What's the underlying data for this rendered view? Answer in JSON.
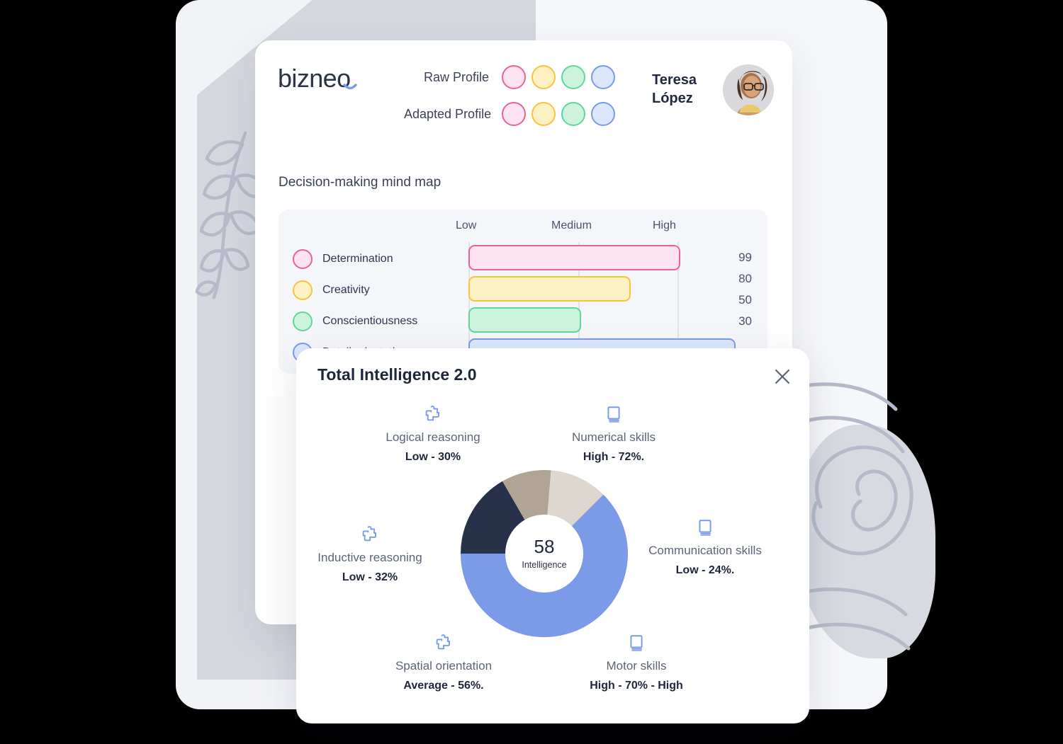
{
  "brand": {
    "logo_text": "bizneo"
  },
  "header": {
    "profile_rows": [
      {
        "label": "Raw Profile",
        "dots": [
          "pink",
          "yellow",
          "green",
          "blue"
        ]
      },
      {
        "label": "Adapted Profile",
        "dots": [
          "pink",
          "yellow",
          "green",
          "blue"
        ]
      }
    ],
    "person": {
      "name_line1": "Teresa",
      "name_line2": "López",
      "avatar_icon": "user-photo"
    }
  },
  "section": {
    "title": "Decision-making mind map"
  },
  "chart_data": {
    "type": "bar",
    "orientation": "horizontal",
    "title": "Decision-making mind map",
    "xlabel": "",
    "ylabel": "",
    "xlim": [
      0,
      100
    ],
    "grid": true,
    "tick_labels": [
      "Low",
      "Medium",
      "High"
    ],
    "tick_values": [
      0,
      50,
      90
    ],
    "categories": [
      "Determination",
      "Creativity",
      "Conscientiousness",
      "Detail orientation"
    ],
    "values": [
      99,
      80,
      50,
      30
    ],
    "value_column": [
      "99",
      "80",
      "50",
      "30"
    ],
    "colors": {
      "Determination": "#e9639b",
      "Creativity": "#f5c53d",
      "Conscientiousness": "#5fd79b",
      "Detail orientation": "#7b9ae8"
    },
    "bar_fills": {
      "Determination": "#fde4ee",
      "Creativity": "#fdf1c6",
      "Conscientiousness": "#cdf3dd",
      "Detail orientation": "#dce7fb"
    }
  },
  "modal": {
    "title": "Total Intelligence 2.0",
    "close_icon": "close-icon",
    "center": {
      "value": "58",
      "caption": "Intelligence"
    },
    "metrics": [
      {
        "icon": "puzzle-icon",
        "name": "Logical reasoning",
        "value": "Low - 30%"
      },
      {
        "icon": "book-icon",
        "name": "Numerical skills",
        "value": "High - 72%."
      },
      {
        "icon": "puzzle-icon",
        "name": "Inductive reasoning",
        "value": "Low - 32%"
      },
      {
        "icon": "book-icon",
        "name": "Communication skills",
        "value": "Low - 24%."
      },
      {
        "icon": "puzzle-icon",
        "name": "Spatial orientation",
        "value": "Average - 56%."
      },
      {
        "icon": "book-icon",
        "name": "Motor skills",
        "value": "High - 70% - High"
      }
    ],
    "donut_chart": {
      "type": "pie",
      "title": "Total Intelligence 2.0",
      "center_value": 58,
      "center_label": "Intelligence",
      "segments": [
        {
          "name": "navy-segment",
          "share_deg": 60,
          "color": "#27324a"
        },
        {
          "name": "taupe-segment",
          "share_deg": 45,
          "color": "#b0a494"
        },
        {
          "name": "beige-segment",
          "share_deg": 45,
          "color": "#ddd7cf"
        },
        {
          "name": "blue-segment",
          "share_deg": 210,
          "color": "#7b9ae8"
        }
      ],
      "legend_position": "around"
    }
  },
  "palette": {
    "accent_blue": "#7b9ae8",
    "navy": "#27324a",
    "taupe": "#b0a494",
    "beige": "#ddd7cf",
    "page_bg": "#000000",
    "card_bg": "#ffffff",
    "panel_bg": "#f5f6f9"
  }
}
